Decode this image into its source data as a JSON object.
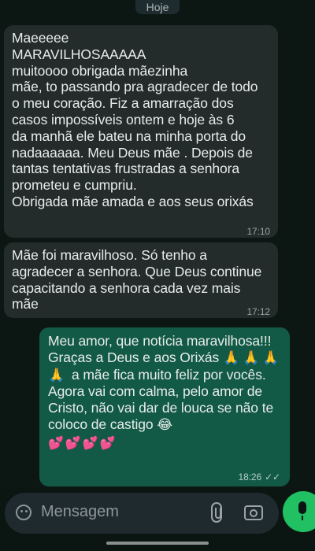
{
  "date_separator": "Hoje",
  "messages": [
    {
      "direction": "incoming",
      "lines": [
        "Maeeeee",
        "MARAVILHOSAAAAA",
        "muitoooo obrigada mãezinha",
        "mãe, to passando pra agradecer de todo",
        "o meu coração. Fiz a amarração dos",
        "casos impossíveis ontem e hoje às 6",
        "da manhã ele bateu na minha porta do",
        "nadaaaaaa. Meu Deus mãe . Depois de",
        "tantas tentativas frustradas a senhora",
        "prometeu e cumpriu.",
        "Obrigada mãe amada e aos seus orixás"
      ],
      "time": "17:10"
    },
    {
      "direction": "incoming",
      "lines": [
        "Mãe foi maravilhoso. Só tenho a",
        "agradecer a senhora. Que Deus continue",
        "capacitando a senhora cada vez mais",
        "mãe"
      ],
      "time": "17:12"
    },
    {
      "direction": "outgoing",
      "lines": [
        "Meu amor, que notícia maravilhosa!!!",
        "Graças a Deus e aos Orixás",
        "a mãe fica muito feliz por vocês.",
        "Agora vai com calma, pelo amor de",
        "Cristo, não vai dar de louca se não te",
        "coloco de castigo"
      ],
      "pray_emojis": "🙏🙏🙏",
      "pray_emoji_single": "🙏",
      "laugh_emoji": "😂",
      "hearts": "💕💕💕💕",
      "time": "18:26",
      "status_icon": "double-check-icon",
      "status_glyph": "✓✓"
    }
  ],
  "composer": {
    "placeholder": "Mensagem"
  },
  "colors": {
    "background": "#0c1714",
    "incoming_bubble": "#232c2b",
    "outgoing_bubble": "#135a46",
    "mic_button": "#21c063"
  }
}
